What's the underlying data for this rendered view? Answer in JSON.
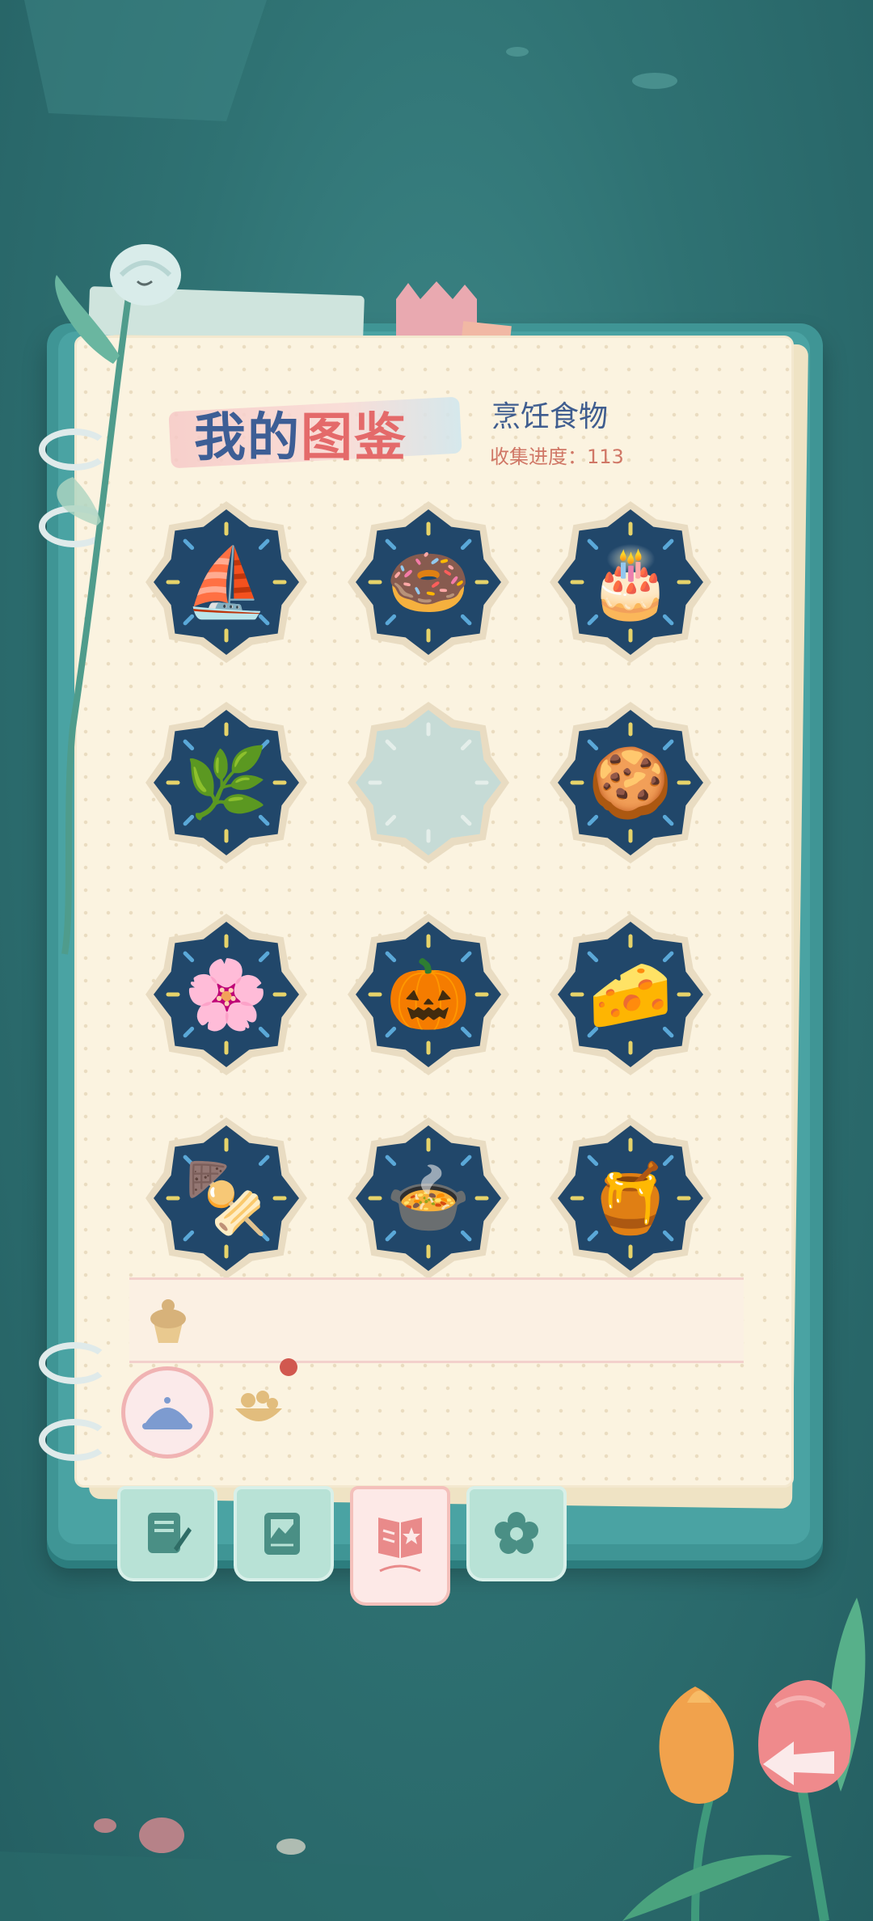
{
  "header": {
    "title_prefix": "我的",
    "title_highlight": "图鉴",
    "category": "烹饪食物",
    "progress_label": "收集进度：",
    "progress_value": "113"
  },
  "colors": {
    "badge_dark": "#21476a",
    "badge_ring": "#e9dcc2",
    "badge_locked": "#c6dbd6",
    "accent_pink": "#e46a6a",
    "title_blue": "#3d5e95",
    "tab_green": "#b8e2d6",
    "tab_active": "#fde9e7"
  },
  "collection": {
    "items": [
      {
        "name": "sailboat-basket-food",
        "icon": "⛵",
        "unlocked": true
      },
      {
        "name": "matcha-donut",
        "icon": "🍩",
        "unlocked": true
      },
      {
        "name": "berry-cake",
        "icon": "🎂",
        "unlocked": true
      },
      {
        "name": "herb-skewer",
        "icon": "🌿",
        "unlocked": true
      },
      {
        "name": "locked-slot",
        "icon": "",
        "unlocked": false
      },
      {
        "name": "heart-cookies",
        "icon": "🍪",
        "unlocked": true
      },
      {
        "name": "flower-biscuits",
        "icon": "🌸",
        "unlocked": true
      },
      {
        "name": "pumpkin-pie",
        "icon": "🎃",
        "unlocked": true
      },
      {
        "name": "cheese-crackers",
        "icon": "🧀",
        "unlocked": true
      },
      {
        "name": "meatball-skewer",
        "icon": "🍢",
        "unlocked": true
      },
      {
        "name": "soup-bucket",
        "icon": "🍲",
        "unlocked": true
      },
      {
        "name": "orange-jam",
        "icon": "🍯",
        "unlocked": true
      }
    ]
  },
  "filters": [
    {
      "name": "cloche-filter",
      "icon": "cloche-icon",
      "active": true
    },
    {
      "name": "ingredients-filter",
      "icon": "ingredients-icon",
      "active": false
    }
  ],
  "tabs": [
    {
      "name": "notes-tab",
      "icon": "pencil-note-icon",
      "active": false
    },
    {
      "name": "album-tab",
      "icon": "photo-album-icon",
      "active": false
    },
    {
      "name": "collection-tab",
      "icon": "star-book-icon",
      "active": true
    },
    {
      "name": "flower-tab",
      "icon": "flower-icon",
      "active": false
    }
  ],
  "back_button": {
    "icon": "back-arrow-icon"
  }
}
